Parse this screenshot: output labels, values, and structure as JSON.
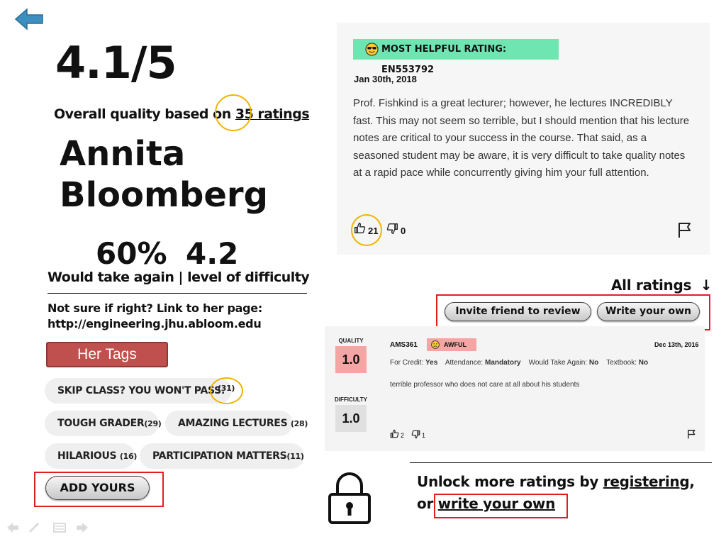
{
  "header": {
    "back_icon": "back-arrow-icon",
    "accent": "#3c8fbf"
  },
  "rating": {
    "score": "4.1/5",
    "overall_prefix": "Overall quality based on ",
    "overall_link": "35 ratings"
  },
  "professor": {
    "first_name": "Annita",
    "last_name": "Bloomberg"
  },
  "stats": {
    "take_again": "60%",
    "difficulty": "4.2",
    "label": "Would take again | level of difficulty"
  },
  "link_info": {
    "line1": "Not sure if right? Link to her page:",
    "line2": "http://engineering.jhu.abloom.edu"
  },
  "tags": {
    "header": "Her Tags",
    "items": [
      {
        "label": "SKIP CLASS? YOU WON'T PASS.",
        "count": "(31)"
      },
      {
        "label": "TOUGH GRADER",
        "count": "(29)"
      },
      {
        "label": "AMAZING LECTURES",
        "count": "(28)"
      },
      {
        "label": "HILARIOUS",
        "count": "(16)"
      },
      {
        "label": "PARTICIPATION MATTERS",
        "count": "(11)"
      }
    ],
    "add_button": "ADD YOURS"
  },
  "most_helpful": {
    "badge": "MOST HELPFUL RATING: EN553792",
    "badge_color": "#6fe5b2",
    "date": "Jan 30th, 2018",
    "text": "Prof. Fishkind is a great lecturer; however, he lectures INCREDIBLY fast. This may not seem so terrible, but I should mention that his lecture notes are critical to your success in the course. That said, as a seasoned student may be aware, it is very difficult to take quality notes at a rapid pace while concurrently giving him your full attention.",
    "thumbs_up": "21",
    "thumbs_down": "0"
  },
  "all_ratings": {
    "label": "All ratings",
    "arrow": "↓",
    "invite_button": "Invite friend to review",
    "write_button": "Write your own"
  },
  "review": {
    "quality_label": "QUALITY",
    "quality": "1.0",
    "quality_color": "#f6a5a5",
    "difficulty_label": "DIFFICULTY",
    "difficulty": "1.0",
    "course": "AMS361",
    "verdict": "AWFUL",
    "date": "Dec 13th, 2016",
    "credit_label": "For Credit:",
    "credit": "Yes",
    "attendance_label": "Attendance:",
    "attendance": "Mandatory",
    "take_again_label": "Would Take Again:",
    "take_again": "No",
    "textbook_label": "Textbook:",
    "textbook": "No",
    "comment": "terrible professor who does not care at all about his students",
    "thumbs_up": "2",
    "thumbs_down": "1"
  },
  "unlock": {
    "prefix": "Unlock more ratings by ",
    "link1": "registering",
    "comma": ",",
    "or": "or ",
    "link2": "write your own"
  }
}
